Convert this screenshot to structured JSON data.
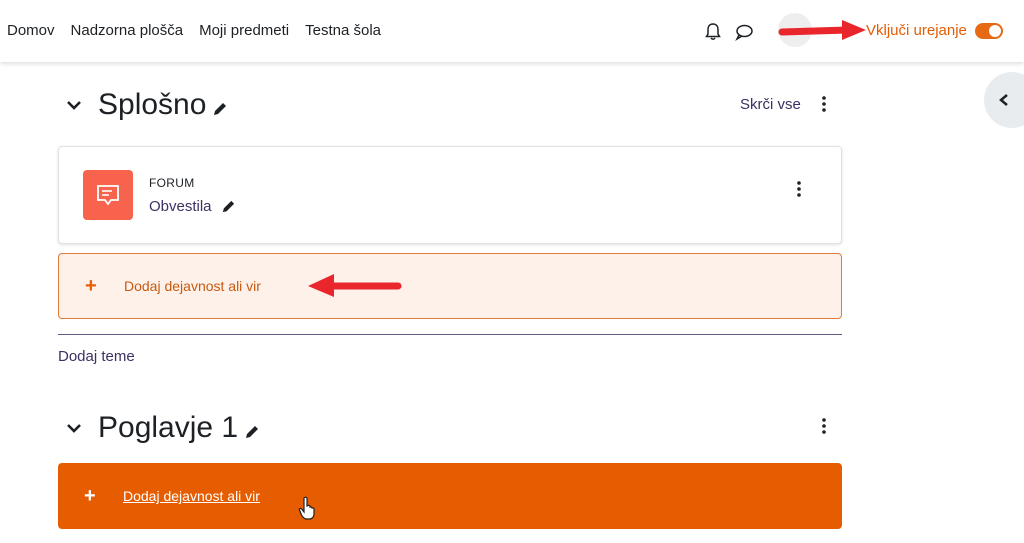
{
  "navbar": {
    "links": [
      "Domov",
      "Nadzorna plošča",
      "Moji predmeti",
      "Testna šola"
    ],
    "icons": [
      "bell-icon",
      "chat-icon"
    ],
    "edit_mode_label": "Vključi urejanje",
    "edit_mode_on": true
  },
  "sections": [
    {
      "title": "Splošno",
      "collapse_all": "Skrči vse",
      "activity": {
        "type": "FORUM",
        "name": "Obvestila"
      },
      "add_activity": "Dodaj dejavnost ali vir",
      "add_topics": "Dodaj teme"
    },
    {
      "title": "Poglavje 1",
      "add_activity": "Dodaj dejavnost ali vir"
    }
  ],
  "colors": {
    "accent": "#e65c00",
    "link": "#3d3063",
    "forum_icon_bg": "#f7634d",
    "annotation_arrow": "#e8262b"
  }
}
